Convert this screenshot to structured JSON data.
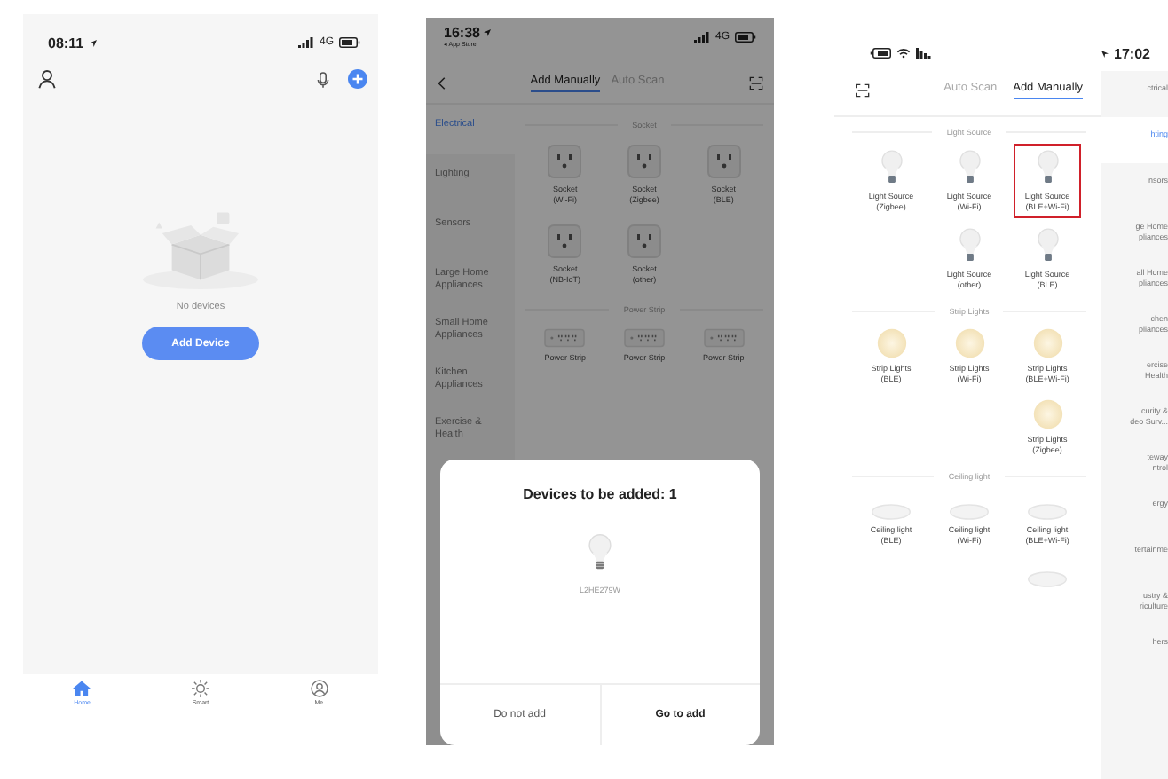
{
  "home_screen": {
    "status_bar": {
      "time": "08:11",
      "network": "4G"
    },
    "empty_state": {
      "message": "No devices"
    },
    "add_button": "Add Device",
    "tab_bar": [
      {
        "label": "Home",
        "selected": true
      },
      {
        "label": "Smart",
        "selected": false
      },
      {
        "label": "Me",
        "selected": false
      }
    ]
  },
  "add_manually_screen": {
    "status_bar": {
      "time": "16:38",
      "back_label": "◂ App Store",
      "network": "4G"
    },
    "tabs": [
      {
        "label": "Add Manually",
        "selected": true
      },
      {
        "label": "Auto Scan",
        "selected": false
      }
    ],
    "categories": [
      {
        "label": "Electrical",
        "selected": true
      },
      {
        "label": "Lighting",
        "selected": false
      },
      {
        "label": "Sensors",
        "selected": false
      },
      {
        "label": "Large Home Appliances",
        "selected": false
      },
      {
        "label": "Small Home Appliances",
        "selected": false
      },
      {
        "label": "Kitchen Appliances",
        "selected": false
      },
      {
        "label": "Exercise & Health",
        "selected": false
      }
    ],
    "sections": [
      {
        "title": "Socket",
        "devices": [
          {
            "kind": "socket",
            "name": "Socket",
            "variant": "(Wi-Fi)"
          },
          {
            "kind": "socket",
            "name": "Socket",
            "variant": "(Zigbee)"
          },
          {
            "kind": "socket",
            "name": "Socket",
            "variant": "(BLE)"
          },
          {
            "kind": "socket",
            "name": "Socket",
            "variant": "(NB-IoT)"
          },
          {
            "kind": "socket",
            "name": "Socket",
            "variant": "(other)"
          }
        ]
      },
      {
        "title": "Power Strip",
        "devices": [
          {
            "kind": "strip",
            "name": "Power Strip"
          },
          {
            "kind": "strip",
            "name": "Power Strip"
          },
          {
            "kind": "strip",
            "name": "Power Strip"
          }
        ]
      }
    ],
    "dialog": {
      "title": "Devices to be added: 1",
      "device_name": "L2HE279W",
      "buttons": [
        {
          "label": "Do not add",
          "primary": false
        },
        {
          "label": "Go to add",
          "primary": true
        }
      ]
    }
  },
  "mirrored_screen": {
    "status_bar": {
      "time": "17:02"
    },
    "tabs": [
      {
        "label": "Auto Scan",
        "selected": false
      },
      {
        "label": "Add Manually",
        "selected": true
      }
    ],
    "categories": [
      {
        "label": "ctrical",
        "selected": false
      },
      {
        "label": "hting",
        "selected": true
      },
      {
        "label": "nsors",
        "selected": false
      },
      {
        "label": "ge Home\npliances",
        "selected": false
      },
      {
        "label": "all Home\npliances",
        "selected": false
      },
      {
        "label": "chen\npliances",
        "selected": false
      },
      {
        "label": "ercise\nHealth",
        "selected": false
      },
      {
        "label": "curity &\ndeo Surv...",
        "selected": false
      },
      {
        "label": "teway\nntrol",
        "selected": false
      },
      {
        "label": "ergy",
        "selected": false
      },
      {
        "label": "tertainme",
        "selected": false
      },
      {
        "label": "ustry &\nriculture",
        "selected": false
      },
      {
        "label": "hers",
        "selected": false
      }
    ],
    "sections": [
      {
        "title": "Light Source",
        "devices": [
          {
            "kind": "bulb",
            "name": "Light Source",
            "variant": "(Zigbee)",
            "highlighted": false
          },
          {
            "kind": "bulb",
            "name": "Light Source",
            "variant": "(Wi-Fi)",
            "highlighted": false
          },
          {
            "kind": "bulb",
            "name": "Light Source",
            "variant": "(BLE+Wi-Fi)",
            "highlighted": true
          },
          {
            "kind": "bulb",
            "name": "Light Source",
            "variant": "(other)",
            "highlighted": false
          },
          {
            "kind": "bulb",
            "name": "Light Source",
            "variant": "(BLE)",
            "highlighted": false
          }
        ]
      },
      {
        "title": "Strip Lights",
        "devices": [
          {
            "kind": "strip_light",
            "name": "Strip Lights",
            "variant": "(BLE)",
            "highlighted": false
          },
          {
            "kind": "strip_light",
            "name": "Strip Lights",
            "variant": "(Wi-Fi)",
            "highlighted": false
          },
          {
            "kind": "strip_light",
            "name": "Strip Lights",
            "variant": "(BLE+Wi-Fi)",
            "highlighted": false
          },
          {
            "kind": "strip_light",
            "name": "Strip Lights",
            "variant": "(Zigbee)",
            "highlighted": false
          }
        ]
      },
      {
        "title": "Ceiling light",
        "devices": [
          {
            "kind": "ceiling",
            "name": "Ceiling light",
            "variant": "(BLE)",
            "highlighted": false
          },
          {
            "kind": "ceiling",
            "name": "Ceiling light",
            "variant": "(Wi-Fi)",
            "highlighted": false
          },
          {
            "kind": "ceiling",
            "name": "Ceiling light",
            "variant": "(BLE+Wi-Fi)",
            "highlighted": false
          },
          {
            "kind": "ceiling",
            "highlighted": false
          }
        ]
      }
    ]
  }
}
